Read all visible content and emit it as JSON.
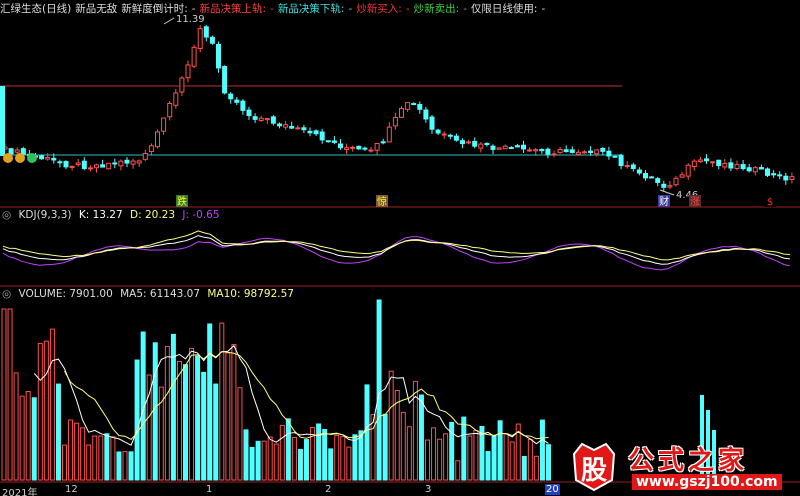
{
  "header": {
    "items": [
      {
        "text": "汇绿生态(日线)",
        "color": "#dddddd"
      },
      {
        "text": "新品无敌",
        "color": "#dddddd"
      },
      {
        "text": "新鲜度倒计时:",
        "color": "#dddddd"
      },
      {
        "text": "-",
        "color": "#dddddd"
      },
      {
        "text": "新品决策上轨:",
        "color": "#ff4040"
      },
      {
        "text": "-",
        "color": "#ff4040"
      },
      {
        "text": "新品决策下轨:",
        "color": "#40e0e0"
      },
      {
        "text": "-",
        "color": "#40e0e0"
      },
      {
        "text": "炒新买入:",
        "color": "#ff3030"
      },
      {
        "text": "-",
        "color": "#ff3030"
      },
      {
        "text": "炒新卖出:",
        "color": "#40d040"
      },
      {
        "text": "-",
        "color": "#40d040"
      },
      {
        "text": "仅限日线使用:",
        "color": "#dddddd"
      },
      {
        "text": "-",
        "color": "#dddddd"
      }
    ]
  },
  "price_panel": {
    "max_label": "11.39",
    "min_label": "4.46",
    "markers": [
      {
        "text": "跌",
        "color": "#ffff00",
        "bg": "#3a7a3a"
      },
      {
        "text": "惊",
        "color": "#ffff00",
        "bg": "#7a5a3a"
      },
      {
        "text": "财",
        "color": "#ffffff",
        "bg": "#3a3a9a"
      },
      {
        "text": "涨",
        "color": "#ff4040",
        "bg": "#5a2a2a"
      },
      {
        "text": "$",
        "color": "#ff3030",
        "bg": "#000000"
      }
    ]
  },
  "kdj_panel": {
    "label": "KDJ(9,3,3)",
    "k_label": "K: 13.27",
    "d_label": "D: 20.23",
    "j_label": "J: -0.65"
  },
  "volume_panel": {
    "label": "VOLUME: 7901.00",
    "ma5_label": "MA5: 61143.07",
    "ma10_label": "MA10: 98792.57"
  },
  "x_axis": {
    "labels": [
      "2021年",
      "12",
      "1",
      "2",
      "3",
      "20"
    ]
  },
  "watermark": {
    "logo_char": "股",
    "title": "公式之家",
    "url": "www.gszj100.com"
  },
  "colors": {
    "up": "#ff5050",
    "down": "#50ffff",
    "k": "#ffffff",
    "d": "#ffff80",
    "j": "#c040ff",
    "upper_line": "#c03030",
    "lower_line": "#30c0c0"
  }
}
